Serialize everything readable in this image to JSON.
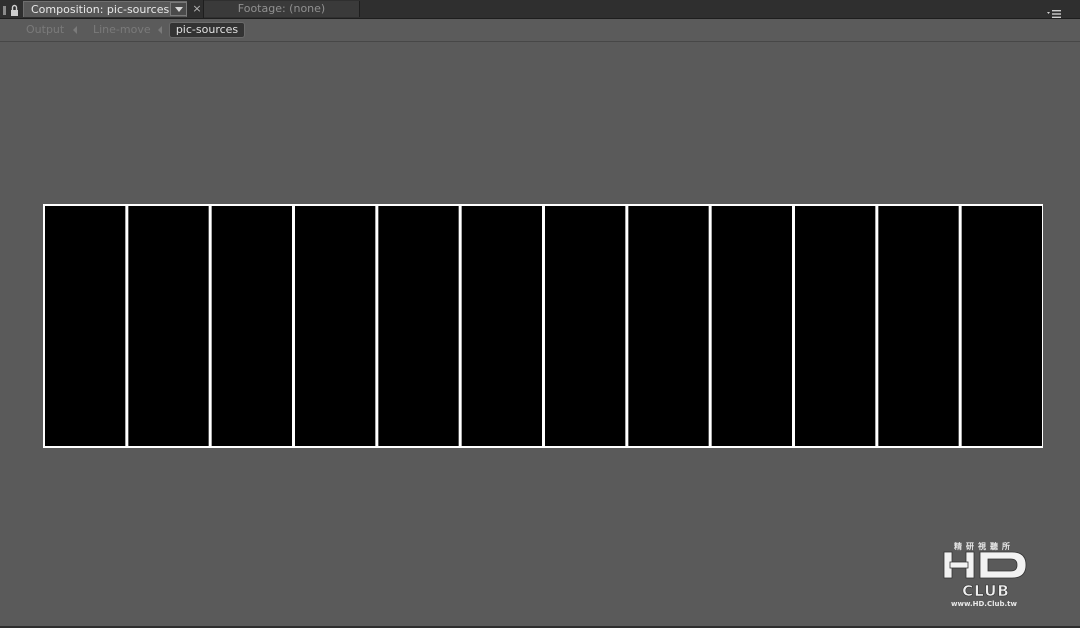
{
  "tabs": {
    "active_label": "Composition: pic-sources",
    "close_glyph": "×",
    "inactive_label": "Footage: (none)"
  },
  "icons": {
    "lock": "lock-icon",
    "dropdown": "chevron-down-icon",
    "close": "close-icon",
    "panel_menu": "panel-menu-icon",
    "breadcrumb_arrow": "triangle-left-icon"
  },
  "breadcrumb": {
    "items": [
      "Output",
      "Line-move",
      "pic-sources"
    ]
  },
  "composition": {
    "strip_count": 12,
    "strip_color": "#000000",
    "border_color": "#ffffff"
  },
  "watermark": {
    "logo_text": "HD CLUB",
    "chinese_text": "精研視聽所",
    "url_text": "www.HD.Club.tw"
  },
  "colors": {
    "background": "#5a5a5a",
    "tab_bar": "#2f2f2f"
  }
}
